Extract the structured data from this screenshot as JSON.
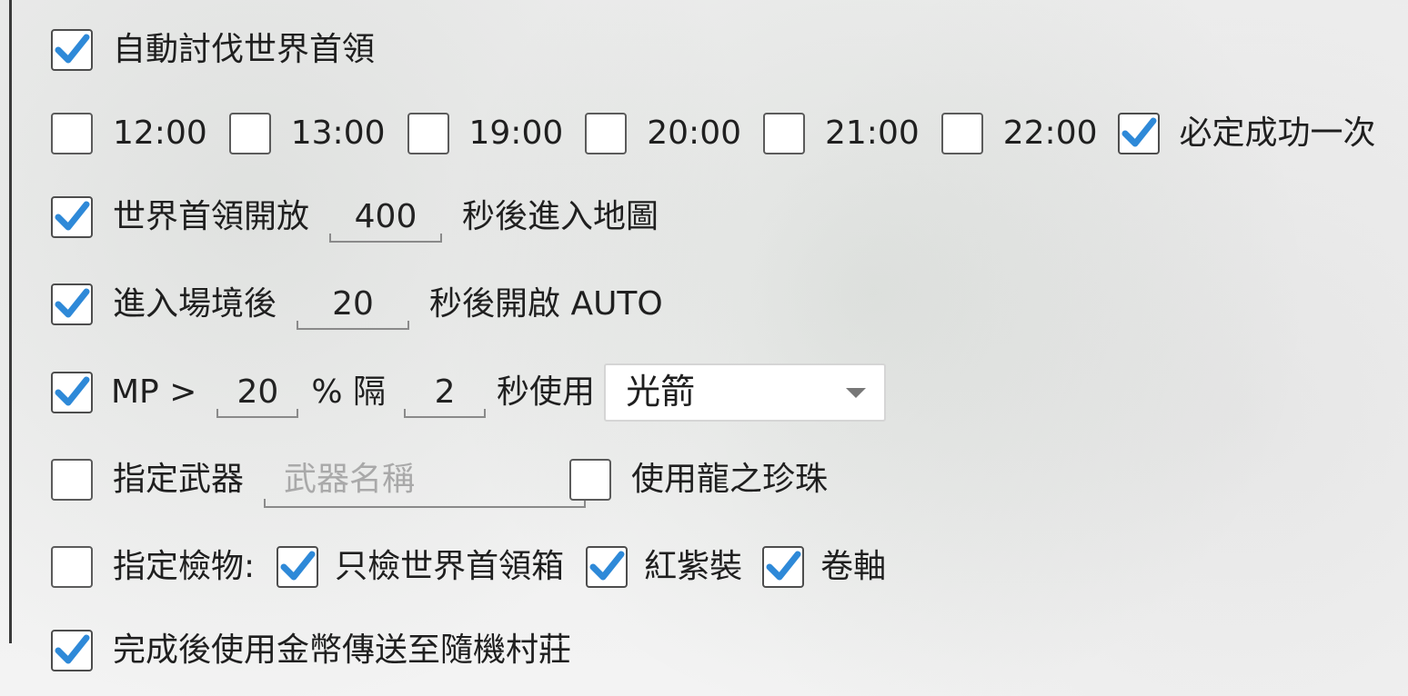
{
  "accent_color": "#2e89d8",
  "rows": {
    "auto_boss": {
      "label": "自動討伐世界首領",
      "checked": true
    },
    "times": [
      {
        "label": "12:00",
        "checked": false
      },
      {
        "label": "13:00",
        "checked": false
      },
      {
        "label": "19:00",
        "checked": false
      },
      {
        "label": "20:00",
        "checked": false
      },
      {
        "label": "21:00",
        "checked": false
      },
      {
        "label": "22:00",
        "checked": false
      }
    ],
    "must_succeed": {
      "label": "必定成功一次",
      "checked": true
    },
    "boss_open": {
      "label": "世界首領開放",
      "value": "400",
      "suffix": "秒後進入地圖",
      "checked": true
    },
    "enter_scene": {
      "label": "進入場境後",
      "value": "20",
      "suffix": "秒後開啟 AUTO",
      "checked": true
    },
    "mp": {
      "label": "MP >",
      "percent_value": "20",
      "percent_label": "% 隔",
      "interval_value": "2",
      "interval_label": "秒使用",
      "skill_selected": "光箭",
      "checked": true
    },
    "weapon": {
      "label": "指定武器",
      "placeholder": "武器名稱",
      "checked": false
    },
    "dragon_pearl": {
      "label": "使用龍之珍珠",
      "checked": false
    },
    "loot": {
      "label": "指定檢物:",
      "checked": false,
      "options": [
        {
          "label": "只檢世界首領箱",
          "checked": true
        },
        {
          "label": "紅紫裝",
          "checked": true
        },
        {
          "label": "卷軸",
          "checked": true
        }
      ]
    },
    "teleport": {
      "label": "完成後使用金幣傳送至隨機村莊",
      "checked": true
    }
  }
}
